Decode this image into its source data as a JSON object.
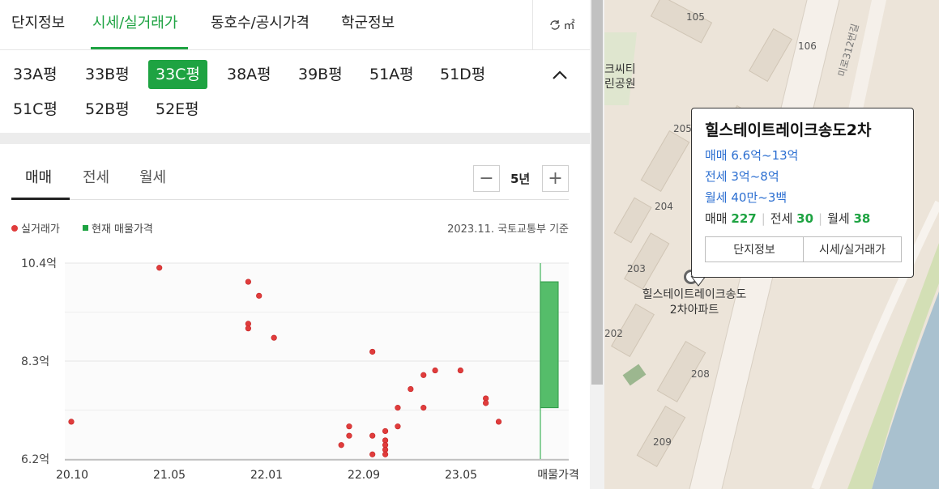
{
  "main_tabs": [
    "단지정보",
    "시세/실거래가",
    "동호수/공시가격",
    "학군정보"
  ],
  "area_unit": {
    "icon": "refresh-icon",
    "label": "㎡"
  },
  "size_chips": [
    "33A평",
    "33B평",
    "33C평",
    "38A평",
    "39B평",
    "51A평",
    "51D평",
    "51C평",
    "52B평",
    "52E평"
  ],
  "selected_size": "33C평",
  "deal_tabs": [
    "매매",
    "전세",
    "월세"
  ],
  "period": {
    "label": "5년",
    "minus": "−",
    "plus": "+"
  },
  "legend": {
    "real_deal": "실거래가",
    "current_listing": "현재 매물가격"
  },
  "source_note": "2023.11. 국토교통부 기준",
  "colors": {
    "accent": "#1ea342",
    "dot": "#e03c3c",
    "price_blue": "#2c6fd1"
  },
  "chart_data": {
    "type": "scatter",
    "x_ticks": [
      "20.10",
      "21.05",
      "22.01",
      "22.09",
      "23.05"
    ],
    "x_last_label": "매물가격",
    "y_ticks": [
      "10.4억",
      "8.3억",
      "6.2억"
    ],
    "ylim": [
      6.2,
      10.4
    ],
    "points": [
      {
        "x": "2020-10-20",
        "y": 7.0
      },
      {
        "x": "2021-05-20",
        "y": 10.3
      },
      {
        "x": "2021-12-20",
        "y": 10.0
      },
      {
        "x": "2022-01-15",
        "y": 9.7
      },
      {
        "x": "2021-12-20",
        "y": 9.1
      },
      {
        "x": "2021-12-20",
        "y": 9.0
      },
      {
        "x": "2022-02-20",
        "y": 8.8
      },
      {
        "x": "2022-08-01",
        "y": 6.5
      },
      {
        "x": "2022-08-20",
        "y": 6.9
      },
      {
        "x": "2022-08-20",
        "y": 6.7
      },
      {
        "x": "2022-10-15",
        "y": 8.5
      },
      {
        "x": "2022-10-15",
        "y": 6.7
      },
      {
        "x": "2022-10-15",
        "y": 6.3
      },
      {
        "x": "2022-11-15",
        "y": 6.8
      },
      {
        "x": "2022-11-15",
        "y": 6.6
      },
      {
        "x": "2022-11-15",
        "y": 6.5
      },
      {
        "x": "2022-11-15",
        "y": 6.4
      },
      {
        "x": "2022-11-15",
        "y": 6.3
      },
      {
        "x": "2022-12-15",
        "y": 7.3
      },
      {
        "x": "2022-12-15",
        "y": 6.9
      },
      {
        "x": "2023-01-15",
        "y": 7.7
      },
      {
        "x": "2023-02-15",
        "y": 8.0
      },
      {
        "x": "2023-02-15",
        "y": 7.3
      },
      {
        "x": "2023-03-15",
        "y": 8.1
      },
      {
        "x": "2023-05-15",
        "y": 8.1
      },
      {
        "x": "2023-07-15",
        "y": 7.5
      },
      {
        "x": "2023-07-15",
        "y": 7.4
      },
      {
        "x": "2023-08-15",
        "y": 7.0
      }
    ],
    "listing_range": [
      7.3,
      10.0
    ]
  },
  "map": {
    "building_labels": [
      "105",
      "106",
      "205",
      "204",
      "203",
      "202",
      "208",
      "209"
    ],
    "road_label": "미로312번길",
    "park_label_1": "크씨티",
    "park_label_2": "린공원",
    "complex_label_1": "힐스테이트레이크송도",
    "complex_label_2": "2차아파트"
  },
  "popup": {
    "title": "힐스테이트레이크송도2차",
    "sale_range": "매매 6.6억~13억",
    "jeonse_range": "전세 3억~8억",
    "monthly_range": "월세 40만~3백",
    "count_sale_label": "매매",
    "count_sale": "227",
    "count_jeonse_label": "전세",
    "count_jeonse": "30",
    "count_monthly_label": "월세",
    "count_monthly": "38",
    "btn_info": "단지정보",
    "btn_price": "시세/실거래가"
  }
}
